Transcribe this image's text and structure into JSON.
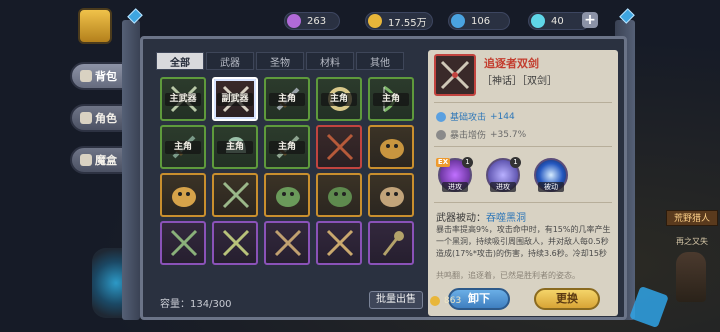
{
  "resources": [
    {
      "name": "purple-gem",
      "value": "263",
      "color": "#b06ad8"
    },
    {
      "name": "gold-coin",
      "value": "17.55万",
      "color": "#e8b63a"
    },
    {
      "name": "blue-orb",
      "value": "106",
      "color": "#4aa3e0"
    },
    {
      "name": "diamond",
      "value": "40",
      "color": "#5fd6e8"
    }
  ],
  "sidebar": {
    "items": [
      {
        "label": "背包",
        "active": true,
        "icon": "backpack-icon"
      },
      {
        "label": "角色",
        "active": false,
        "icon": "character-icon"
      },
      {
        "label": "魔盒",
        "active": false,
        "icon": "magic-box-icon"
      }
    ]
  },
  "tabs": [
    "全部",
    "武器",
    "圣物",
    "材料",
    "其他"
  ],
  "inventory": {
    "items": [
      {
        "quality": "green",
        "tag": "主武器",
        "art": "crossed-blades",
        "color": "#b9c9a8"
      },
      {
        "quality": "red",
        "tag": "副武器",
        "art": "crossed-swords",
        "color": "#d8d1c4",
        "selected": true
      },
      {
        "quality": "green",
        "tag": "主角",
        "art": "sword",
        "color": "#9aa3a8"
      },
      {
        "quality": "green",
        "tag": "主角",
        "art": "ring",
        "color": "#d8c88a"
      },
      {
        "quality": "green",
        "tag": "主角",
        "art": "bow",
        "color": "#7fb86a"
      },
      {
        "quality": "green",
        "tag": "主角",
        "art": "blade",
        "color": "#7a9a88"
      },
      {
        "quality": "green",
        "tag": "主角",
        "art": "helm",
        "color": "#9ac0a8"
      },
      {
        "quality": "green",
        "tag": "主角",
        "art": "sword",
        "color": "#8ea590"
      },
      {
        "quality": "red",
        "tag": "",
        "art": "crossed-swords",
        "color": "#b65a3a"
      },
      {
        "quality": "orange",
        "tag": "",
        "art": "beast",
        "color": "#c8953f"
      },
      {
        "quality": "orange",
        "tag": "",
        "art": "beast",
        "color": "#d6a34a"
      },
      {
        "quality": "orange",
        "tag": "",
        "art": "crossed-blades",
        "color": "#9bb88a"
      },
      {
        "quality": "orange",
        "tag": "",
        "art": "dragon",
        "color": "#6a9a5a"
      },
      {
        "quality": "orange",
        "tag": "",
        "art": "dragon",
        "color": "#5e8a4e"
      },
      {
        "quality": "orange",
        "tag": "",
        "art": "beast",
        "color": "#c2a47a"
      },
      {
        "quality": "purple",
        "tag": "",
        "art": "crossed-blades",
        "color": "#8ab07a"
      },
      {
        "quality": "purple",
        "tag": "",
        "art": "crossed-swords",
        "color": "#b8c27a"
      },
      {
        "quality": "purple",
        "tag": "",
        "art": "crossed-swords",
        "color": "#c0a070"
      },
      {
        "quality": "purple",
        "tag": "",
        "art": "crossed-swords",
        "color": "#c9a86e"
      },
      {
        "quality": "purple",
        "tag": "",
        "art": "scepter",
        "color": "#b3a26a"
      }
    ],
    "capacity_label": "容量：",
    "capacity_value": "134/300",
    "batch_sell": "批量出售"
  },
  "detail": {
    "name": "追逐者双剑",
    "tags": "［神话］［双剑］",
    "stats": [
      {
        "label": "基础攻击",
        "value": "+144",
        "color": "#5aa0e0"
      },
      {
        "label": "暴击增伤",
        "value": "+35.7%",
        "color": "#8a8a8a"
      }
    ],
    "skills": [
      {
        "badge": "EX",
        "level": "1",
        "caption": "进攻",
        "color": "#7a3ad0"
      },
      {
        "level": "1",
        "caption": "进攻",
        "color": "#6f63d8"
      },
      {
        "caption": "被动",
        "color": "#2e5ec8"
      }
    ],
    "passive_label": "武器被动：",
    "passive_name": "吞噬黑洞",
    "passive_text": "暴击率提高9%，攻击命中时，有15%的几率产生一个黑洞，持续吸引周围敌人，并对敌人每0.5秒造成(17%*攻击)的伤害，持续3.6秒。冷却15秒",
    "flavor": "共鸣翻，追逐着，已然是胜利者的姿态。",
    "unequip": "卸下",
    "swap": "更换"
  },
  "coins": "863",
  "scene": {
    "sign": "荒野猎人",
    "text": "再之又失"
  }
}
